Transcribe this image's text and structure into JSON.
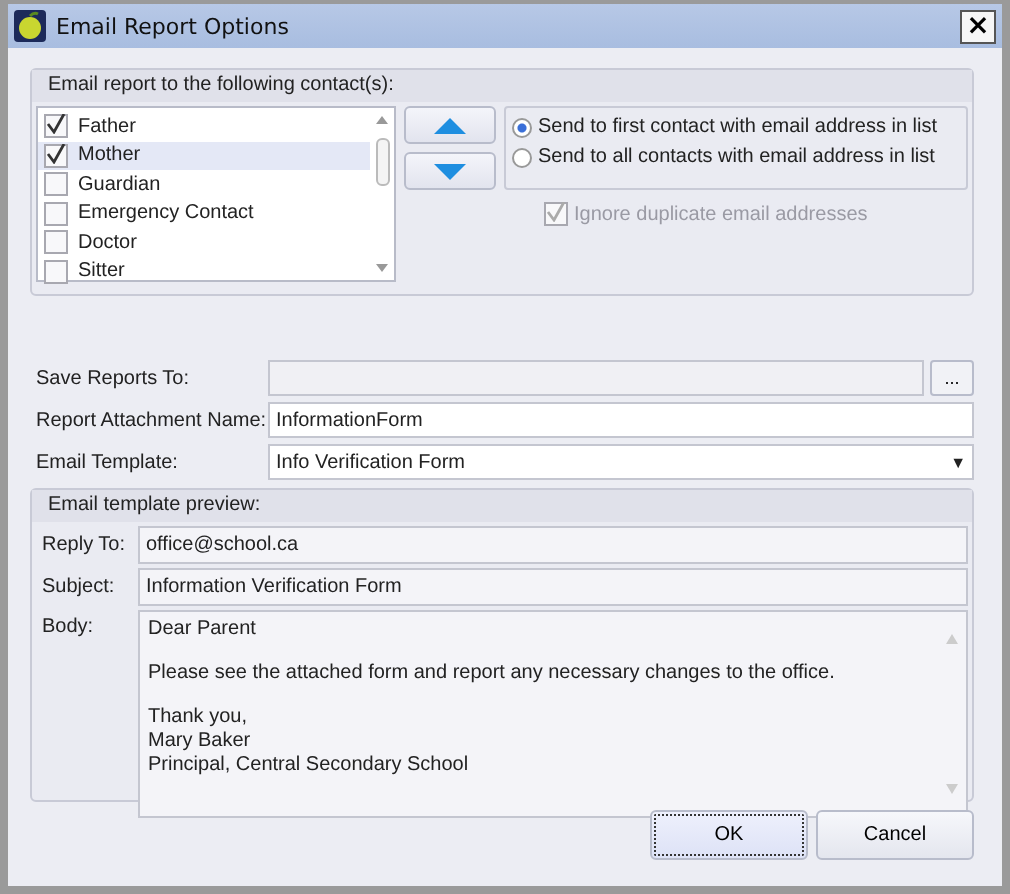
{
  "window": {
    "title": "Email Report Options",
    "close": "×"
  },
  "contacts": {
    "heading": "Email report to the following contact(s):",
    "items": [
      {
        "label": "Father",
        "checked": true,
        "selected": false
      },
      {
        "label": "Mother",
        "checked": true,
        "selected": true
      },
      {
        "label": "Guardian",
        "checked": false,
        "selected": false
      },
      {
        "label": "Emergency Contact",
        "checked": false,
        "selected": false
      },
      {
        "label": "Doctor",
        "checked": false,
        "selected": false
      },
      {
        "label": "Sitter",
        "checked": false,
        "selected": false
      }
    ],
    "send_options": [
      {
        "label": "Send to first contact with email address in list",
        "selected": true
      },
      {
        "label": "Send to all contacts with email address in list",
        "selected": false
      }
    ],
    "ignore_duplicates": {
      "label": "Ignore duplicate email addresses",
      "checked": true,
      "disabled": true
    }
  },
  "save_reports_to": {
    "label": "Save Reports To:",
    "browse": "...",
    "disabled": true
  },
  "attachment_name": {
    "label": "Report Attachment Name:",
    "value": "InformationForm"
  },
  "email_template": {
    "label": "Email Template:",
    "value": "Info Verification Form",
    "arrow": "▼"
  },
  "preview": {
    "heading": "Email template preview:",
    "reply_to": {
      "label": "Reply To:",
      "value": "office@school.ca"
    },
    "subject": {
      "label": "Subject:",
      "value": "Information Verification Form"
    },
    "body": {
      "label": "Body:",
      "paragraphs": [
        "Dear Parent",
        "Please see the attached form and report any necessary changes to the office.",
        "Thank you,\nMary Baker\nPrincipal, Central Secondary School"
      ]
    }
  },
  "buttons": [
    {
      "label": "OK",
      "focused": true
    },
    {
      "label": "Cancel",
      "focused": false
    }
  ]
}
